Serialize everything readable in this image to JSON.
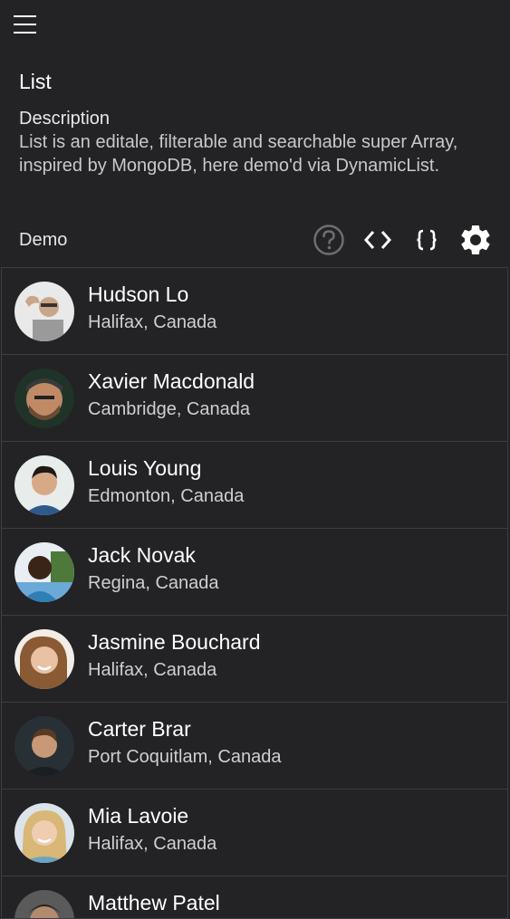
{
  "header": {
    "title": "List",
    "description_label": "Description",
    "description_text": "List is an editale, filterable and searchable super Array, inspired by MongoDB, here demo'd via DynamicList."
  },
  "demo": {
    "label": "Demo",
    "icons": [
      "help-icon",
      "code-icon",
      "braces-icon",
      "settings-icon"
    ]
  },
  "list": {
    "items": [
      {
        "name": "Hudson Lo",
        "city": "Halifax, Canada",
        "avatar": "avatar-photo"
      },
      {
        "name": "Xavier Macdonald",
        "city": "Cambridge, Canada",
        "avatar": "avatar-photo"
      },
      {
        "name": "Louis Young",
        "city": "Edmonton, Canada",
        "avatar": "avatar-photo"
      },
      {
        "name": "Jack Novak",
        "city": "Regina, Canada",
        "avatar": "avatar-photo"
      },
      {
        "name": "Jasmine Bouchard",
        "city": "Halifax, Canada",
        "avatar": "avatar-photo"
      },
      {
        "name": "Carter Brar",
        "city": "Port Coquitlam, Canada",
        "avatar": "avatar-photo"
      },
      {
        "name": "Mia Lavoie",
        "city": "Halifax, Canada",
        "avatar": "avatar-photo"
      },
      {
        "name": "Matthew Patel",
        "city": "",
        "avatar": "avatar-photo"
      }
    ]
  },
  "colors": {
    "background": "#232225",
    "divider": "#3e3e42",
    "text_primary": "#ffffff",
    "text_secondary": "#cfcfcf",
    "help_icon": "#6e6e72"
  }
}
